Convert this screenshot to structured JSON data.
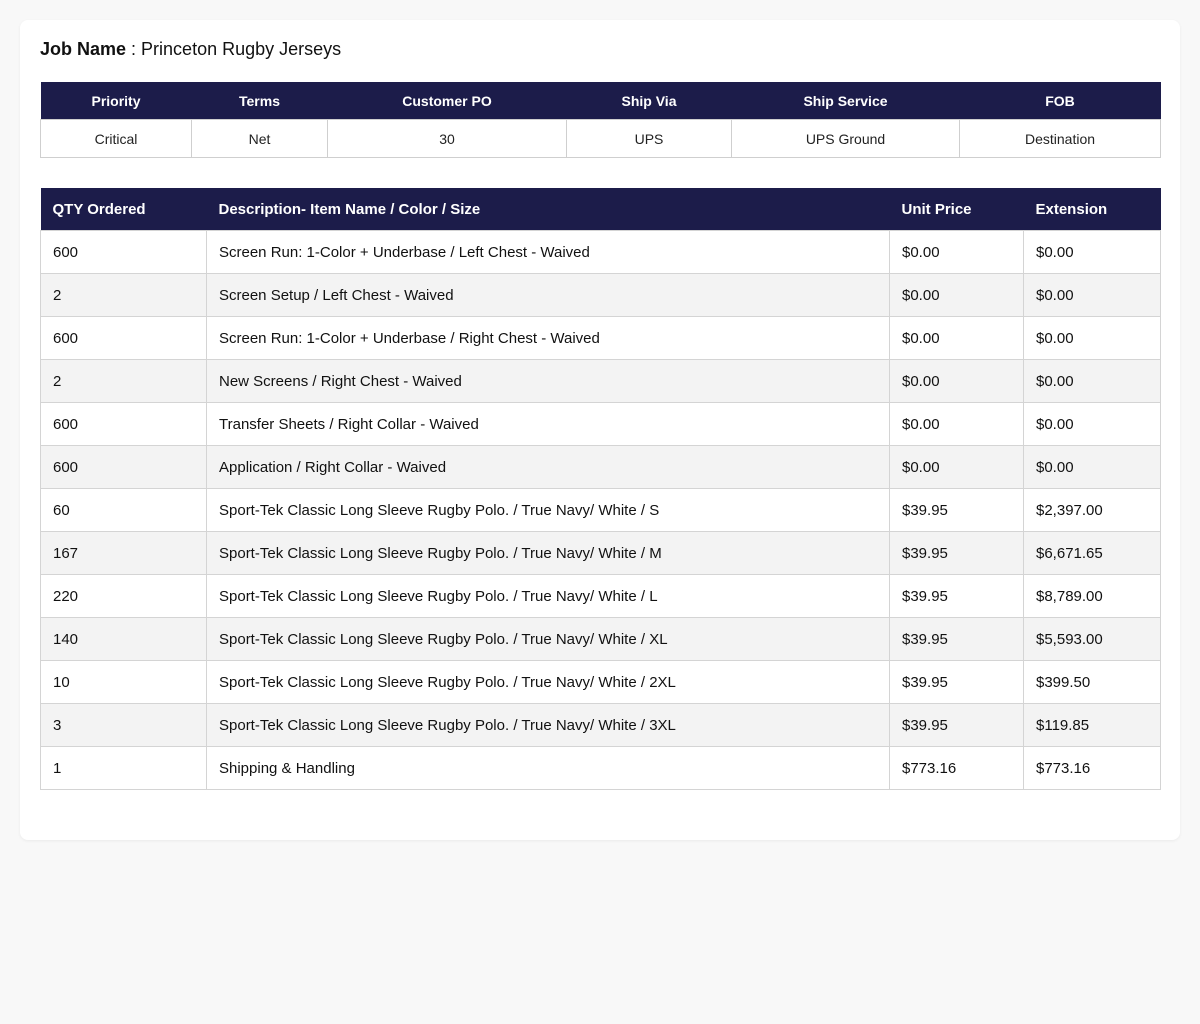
{
  "job": {
    "label": "Job Name",
    "separator": " : ",
    "value": "Princeton Rugby Jerseys"
  },
  "meta": {
    "headers": [
      "Priority",
      "Terms",
      "Customer PO",
      "Ship Via",
      "Ship Service",
      "FOB"
    ],
    "values": [
      "Critical",
      "Net",
      "30",
      "UPS",
      "UPS Ground",
      "Destination"
    ]
  },
  "items": {
    "headers": [
      "QTY Ordered",
      "Description- Item Name / Color / Size",
      "Unit Price",
      "Extension"
    ],
    "rows": [
      [
        "600",
        "Screen Run: 1-Color + Underbase / Left Chest - Waived",
        "$0.00",
        "$0.00"
      ],
      [
        "2",
        "Screen Setup / Left Chest - Waived",
        "$0.00",
        "$0.00"
      ],
      [
        "600",
        "Screen Run: 1-Color + Underbase / Right Chest - Waived",
        "$0.00",
        "$0.00"
      ],
      [
        "2",
        "New Screens / Right Chest - Waived",
        "$0.00",
        "$0.00"
      ],
      [
        "600",
        "Transfer Sheets / Right Collar - Waived",
        "$0.00",
        "$0.00"
      ],
      [
        "600",
        "Application / Right Collar - Waived",
        "$0.00",
        "$0.00"
      ],
      [
        "60",
        "Sport-Tek Classic Long Sleeve Rugby Polo. / True Navy/ White / S",
        "$39.95",
        "$2,397.00"
      ],
      [
        "167",
        "Sport-Tek Classic Long Sleeve Rugby Polo. / True Navy/ White / M",
        "$39.95",
        "$6,671.65"
      ],
      [
        "220",
        "Sport-Tek Classic Long Sleeve Rugby Polo. / True Navy/ White / L",
        "$39.95",
        "$8,789.00"
      ],
      [
        "140",
        "Sport-Tek Classic Long Sleeve Rugby Polo. / True Navy/ White / XL",
        "$39.95",
        "$5,593.00"
      ],
      [
        "10",
        "Sport-Tek Classic Long Sleeve Rugby Polo. / True Navy/ White / 2XL",
        "$39.95",
        "$399.50"
      ],
      [
        "3",
        "Sport-Tek Classic Long Sleeve Rugby Polo. / True Navy/ White / 3XL",
        "$39.95",
        "$119.85"
      ],
      [
        "1",
        "Shipping & Handling",
        "$773.16",
        "$773.16"
      ]
    ]
  },
  "colors": {
    "header_bg": "#1c1c4a",
    "header_text": "#ffffff",
    "alt_row": "#f3f3f3"
  }
}
